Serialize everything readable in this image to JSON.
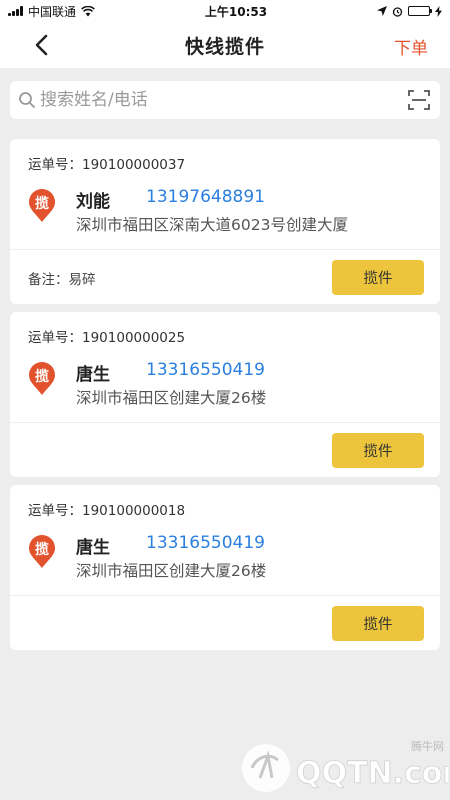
{
  "status": {
    "carrier": "中国联通",
    "time": "上午10:53"
  },
  "nav": {
    "title": "快线揽件",
    "order_label": "下单"
  },
  "search": {
    "placeholder": "搜索姓名/电话",
    "value": ""
  },
  "orders": [
    {
      "waybill_label": "运单号：190100000037",
      "pin_label": "揽",
      "name": "刘能",
      "phone": "13197648891",
      "address": "深圳市福田区深南大道6023号创建大厦",
      "remark": "备注：易碎",
      "action_label": "揽件"
    },
    {
      "waybill_label": "运单号：190100000025",
      "pin_label": "揽",
      "name": "唐生",
      "phone": "13316550419",
      "address": "深圳市福田区创建大厦26楼",
      "remark": "",
      "action_label": "揽件"
    },
    {
      "waybill_label": "运单号：190100000018",
      "pin_label": "揽",
      "name": "唐生",
      "phone": "13316550419",
      "address": "深圳市福田区创建大厦26楼",
      "remark": "",
      "action_label": "揽件"
    }
  ],
  "watermark": {
    "text": "QQTN.com",
    "small": "腾牛网"
  },
  "colors": {
    "accent_red": "#e2532d",
    "link_blue": "#2a7fe0",
    "button_yellow": "#ecc53d",
    "background": "#ededed"
  },
  "icons": [
    "signal-icon",
    "wifi-icon",
    "location-arrow-icon",
    "alarm-icon",
    "battery-icon",
    "back-chevron-icon",
    "search-icon",
    "scan-icon",
    "map-pin-icon"
  ]
}
